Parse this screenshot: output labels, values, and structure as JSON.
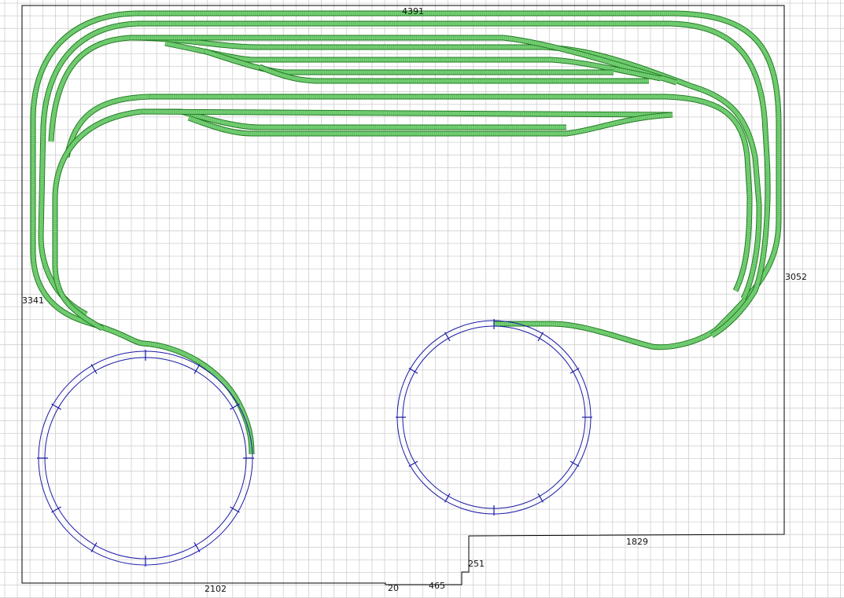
{
  "dimensions": {
    "top": "4391",
    "right": "3052",
    "left": "3341",
    "bottom_left": "2102",
    "bottom_step": "20",
    "bottom_middle": "465",
    "step_vertical": "251",
    "bottom_right": "1829"
  },
  "colors": {
    "grid": "#cfcfcf",
    "outline": "#000000",
    "track_fill": "#5cc35c",
    "track_edge": "#1f7a1f",
    "track_dark": "#2e8b2e",
    "turntable": "#1a1aa8",
    "background": "#ffffff"
  }
}
